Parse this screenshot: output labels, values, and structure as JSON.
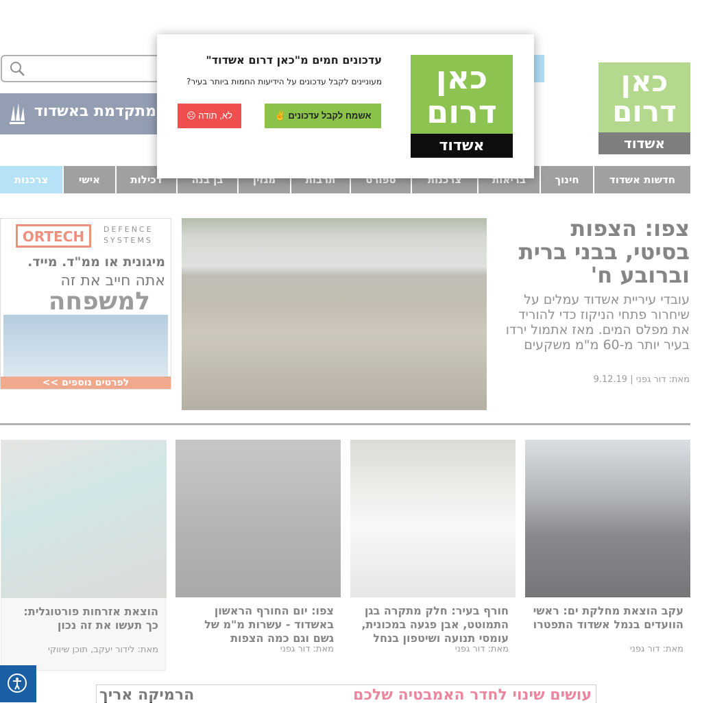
{
  "logo": {
    "line1": "כאן",
    "line2": "דרום",
    "city": "אשדוד"
  },
  "search": {
    "placeholder": ""
  },
  "top_banner": {
    "text": "מתקדמת באשדוד"
  },
  "nav": {
    "items": [
      "חדשות אשדוד",
      "חינוך",
      "בריאות",
      "צרכנות",
      "ספורט",
      "תרבות",
      "מגזין",
      "בן בנה",
      "דכילות",
      "אישי",
      "צרכנות"
    ]
  },
  "main_article": {
    "title": "צפו: הצפות בסיטי, בבני ברית וברובע ח'",
    "summary": "עובדי עיריית אשדוד עמלים על שיחרור פתחי הניקוז כדי להוריד את מפלס המים. מאז אתמול ירדו בעיר יותר מ-60 מ\"מ משקעים",
    "author": "מאת: דור גפני",
    "date": "9.12.19"
  },
  "ortech_ad": {
    "brand": "ORTECH",
    "tagline1": "DEFENCE",
    "tagline2": "SYSTEMS",
    "line1": "מיגונית או ממ\"ד. מייד.",
    "line2": "אתה חייב את זה",
    "line3": "למשפחה",
    "cta": "לפרטים נוספים >>"
  },
  "cards": [
    {
      "title": "עקב הוצאת מחלקת ים: ראשי הוועדים בנמל אשדוד התפטרו",
      "author": "מאת: דור גפני"
    },
    {
      "title": "חורף בעיר: חלק מתקרה בגן התמוטט, אבן פגעה במכונית, עומסי תנועה ושיטפון בנחל",
      "author": "מאת: דור גפני"
    },
    {
      "title": "צפו: יום החורף הראשון באשדוד - עשרות מ\"מ של גשם וגם כמה הצפות",
      "author": "מאת: דור גפני"
    },
    {
      "title": "הוצאת אזרחות פורטוגלית: כך תעשו את זה נכון",
      "author": "מאת: לידור יעקב, תוכן שיווקי"
    }
  ],
  "bottom_ad": {
    "text_right": "עושים שינוי לחדר האמבטיה שלכם",
    "text_left": "הרמיקה אריך"
  },
  "popup": {
    "title": "עדכונים חמים מ\"כאן דרום אשדוד\"",
    "subtitle": "מעוניינים לקבל עדכונים על הידיעות החמות ביותר בעיר?",
    "allow": "אשמח לקבל עדכונים ✌",
    "deny": "לא, תודה ☹",
    "logo_line1": "כאן",
    "logo_line2": "דרום",
    "logo_city": "אשדוד"
  }
}
